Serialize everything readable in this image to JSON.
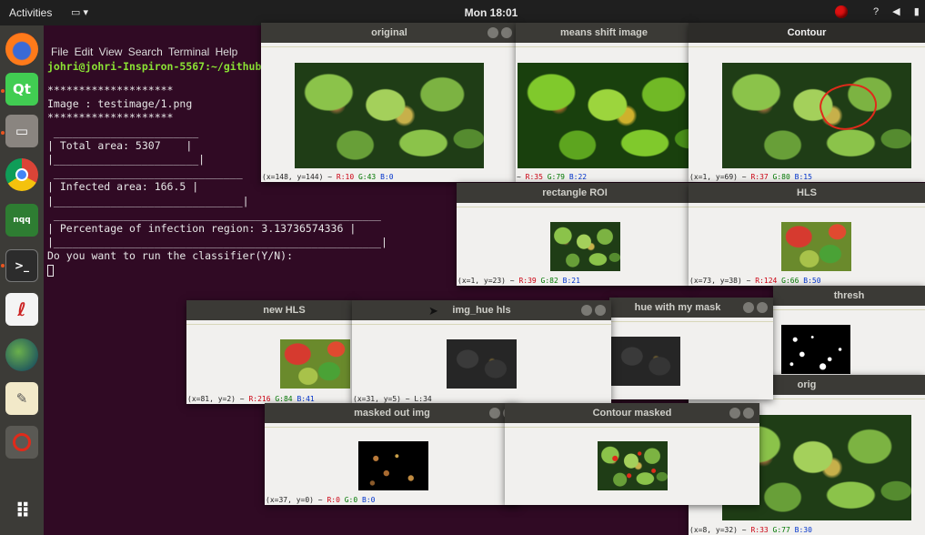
{
  "topbar": {
    "activities": "Activities",
    "clock": "Mon 18:01"
  },
  "dock": {
    "items": [
      "firefox-icon",
      "qt-icon",
      "files-icon",
      "chrome-icon",
      "nqq-icon",
      "terminal-icon",
      "evince-icon",
      "globe-icon",
      "text-editor-icon",
      "disabled-app-icon",
      "app-grid-icon"
    ],
    "labels": {
      "qt": "Qt",
      "nqq": "nqq"
    }
  },
  "terminal": {
    "menu": "File  Edit  View  Search  Terminal  Help",
    "prompt": "johri@johri-Inspiron-5567:~/github/",
    "lines": [
      "********************",
      "Image : testimage/1.png",
      "********************",
      " _______________________",
      "| Total area: 5307    |",
      "|_______________________|",
      "",
      " ______________________________",
      "| Infected area: 166.5 |",
      "|______________________________|",
      "",
      " ____________________________________________________",
      "| Percentage of infection region: 3.13736574336 |",
      "|____________________________________________________|",
      "",
      "Do you want to run the classifier(Y/N):"
    ]
  },
  "windows": {
    "original": {
      "title": "original",
      "status": {
        "pos": "(x=148, y=144) ~ ",
        "r": "R:10",
        "g": "G:43",
        "b": "B:0"
      }
    },
    "means_shift": {
      "title": "means shift image",
      "status": {
        "pos": "~ ",
        "r": "R:35",
        "g": "G:79",
        "b": "B:22"
      }
    },
    "contour": {
      "title": "Contour",
      "status": {
        "pos": "(x=1, y=69) ~ ",
        "r": "R:37",
        "g": "G:80",
        "b": "B:15"
      }
    },
    "rect_roi": {
      "title": "rectangle ROI",
      "status": {
        "pos": "(x=1, y=23) ~ ",
        "r": "R:39",
        "g": "G:82",
        "b": "B:21"
      }
    },
    "hls": {
      "title": "HLS",
      "status": {
        "pos": "(x=73, y=38) ~ ",
        "r": "R:124",
        "g": "G:66",
        "b": "B:50"
      }
    },
    "thresh": {
      "title": "thresh",
      "status": {
        "pos": "",
        "r": "",
        "g": "",
        "b": ""
      }
    },
    "new_hls": {
      "title": "new HLS",
      "status": {
        "pos": "(x=81, y=2) ~ ",
        "r": "R:216",
        "g": "G:84",
        "b": "B:41"
      }
    },
    "img_hue": {
      "title": "img_hue hls",
      "status": {
        "pos": "(x=31, y=5) ~ L:34",
        "r": "",
        "g": "",
        "b": ""
      }
    },
    "hue_mask": {
      "title": "hue with my mask",
      "status": {
        "pos": "",
        "r": "",
        "g": "",
        "b": ""
      }
    },
    "orig": {
      "title": "orig",
      "status": {
        "pos": "(x=8, y=32) ~ ",
        "r": "R:33",
        "g": "G:77",
        "b": "B:30"
      }
    },
    "masked_out": {
      "title": "masked out img",
      "status": {
        "pos": "(x=37, y=0) ~ ",
        "r": "R:0",
        "g": "G:0",
        "b": "B:0"
      }
    },
    "contour_masked": {
      "title": "Contour masked",
      "status": {
        "pos": "",
        "r": "",
        "g": "",
        "b": ""
      }
    }
  }
}
